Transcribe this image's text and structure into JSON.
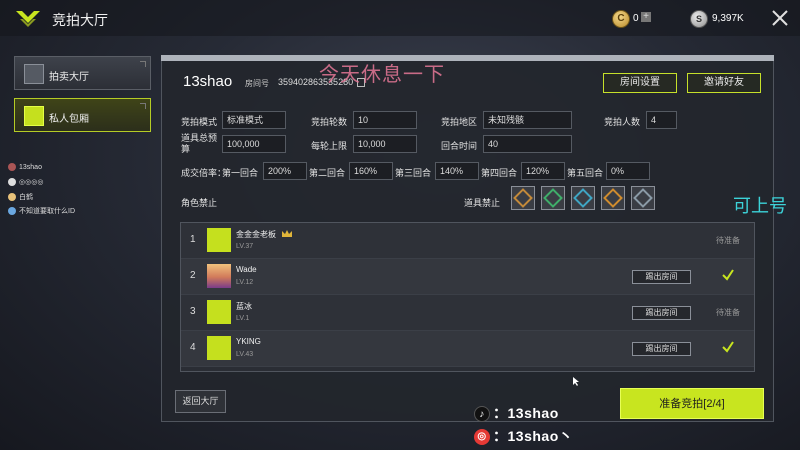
{
  "header": {
    "title": "竞拍大厅",
    "coin_value": "0",
    "silver_value": "9,397K"
  },
  "sidebar": {
    "items": [
      {
        "label": "拍卖大厅"
      },
      {
        "label": "私人包厢"
      }
    ]
  },
  "chat": [
    "13shao",
    "◎◎◎◎",
    "白鹤",
    "不知道要取什么ID"
  ],
  "overlay": {
    "center": "今天休息一下",
    "right": "可上号"
  },
  "room": {
    "name": "13shao",
    "number_label": "房间号",
    "number": "359402863535280",
    "settings_button": "房间设置",
    "invite_button": "邀请好友"
  },
  "settings": {
    "mode_label": "竞拍模式",
    "mode_value": "标准模式",
    "rounds_label": "竞拍轮数",
    "rounds_value": "10",
    "region_label": "竞拍地区",
    "region_value": "未知残骸",
    "players_label": "竞拍人数",
    "players_value": "4",
    "budget_label": "道具总预算",
    "budget_value": "100,000",
    "cap_label": "每轮上限",
    "cap_value": "10,000",
    "round_time_label": "回合时间",
    "round_time_value": "40",
    "multiplier_label": "成交倍率：",
    "multipliers": [
      {
        "label": "第一回合",
        "value": "200%"
      },
      {
        "label": "第二回合",
        "value": "160%"
      },
      {
        "label": "第三回合",
        "value": "140%"
      },
      {
        "label": "第四回合",
        "value": "120%"
      },
      {
        "label": "第五回合",
        "value": "0%"
      }
    ],
    "role_ban_label": "角色禁止",
    "item_ban_label": "道具禁止",
    "item_ban_colors": [
      "#c48a3a",
      "#3fae6a",
      "#3fa6c4",
      "#d08c2e",
      "#8a9aa6"
    ]
  },
  "players": [
    {
      "index": "1",
      "name": "金金金老板",
      "level": "LV.37",
      "status": "待准备",
      "kick": "",
      "ready": false,
      "host": true
    },
    {
      "index": "2",
      "name": "Wade",
      "level": "LV.12",
      "status": "",
      "kick": "踢出房间",
      "ready": true,
      "host": false
    },
    {
      "index": "3",
      "name": "蓝冰",
      "level": "LV.1",
      "status": "待准备",
      "kick": "踢出房间",
      "ready": false,
      "host": false
    },
    {
      "index": "4",
      "name": "YKING",
      "level": "LV.43",
      "status": "",
      "kick": "踢出房间",
      "ready": true,
      "host": false
    }
  ],
  "footer": {
    "back_button": "返回大厅",
    "ready_button": "准备竞拍[2/4]",
    "douyin": "：13shao",
    "netease": "：13shao丶"
  },
  "colors": {
    "accent": "#c8e51f",
    "overlay_pink": "#e67896",
    "overlay_cyan": "#3cd3d9"
  }
}
